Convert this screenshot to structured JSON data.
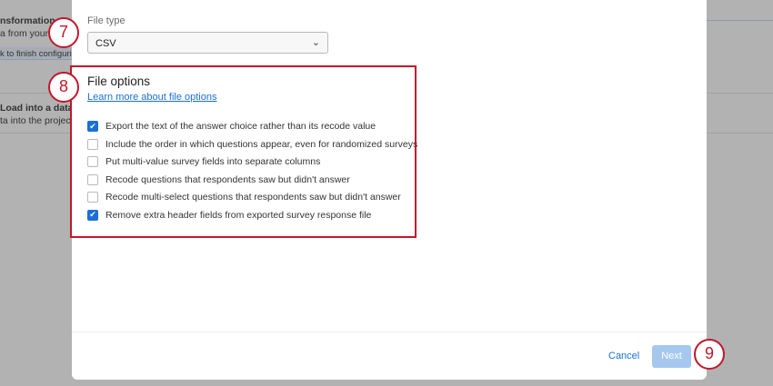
{
  "background": {
    "texts": [
      "nsformation",
      "a from your",
      "k to finish configuring",
      "Load into a data",
      "ta into the project"
    ]
  },
  "file_type": {
    "label": "File type",
    "value": "CSV"
  },
  "file_options": {
    "title": "File options",
    "link": "Learn more about file options",
    "options": [
      {
        "label": "Export the text of the answer choice rather than its recode value",
        "checked": true
      },
      {
        "label": "Include the order in which questions appear, even for randomized surveys",
        "checked": false
      },
      {
        "label": "Put multi-value survey fields into separate columns",
        "checked": false
      },
      {
        "label": "Recode questions that respondents saw but didn't answer",
        "checked": false
      },
      {
        "label": "Recode multi-select questions that respondents saw but didn't answer",
        "checked": false
      },
      {
        "label": "Remove extra header fields from exported survey response file",
        "checked": true
      }
    ]
  },
  "footer": {
    "cancel": "Cancel",
    "next": "Next"
  },
  "callouts": [
    "7",
    "8",
    "9"
  ],
  "colors": {
    "accent": "#1a6fd6",
    "callout": "#c0182b"
  }
}
